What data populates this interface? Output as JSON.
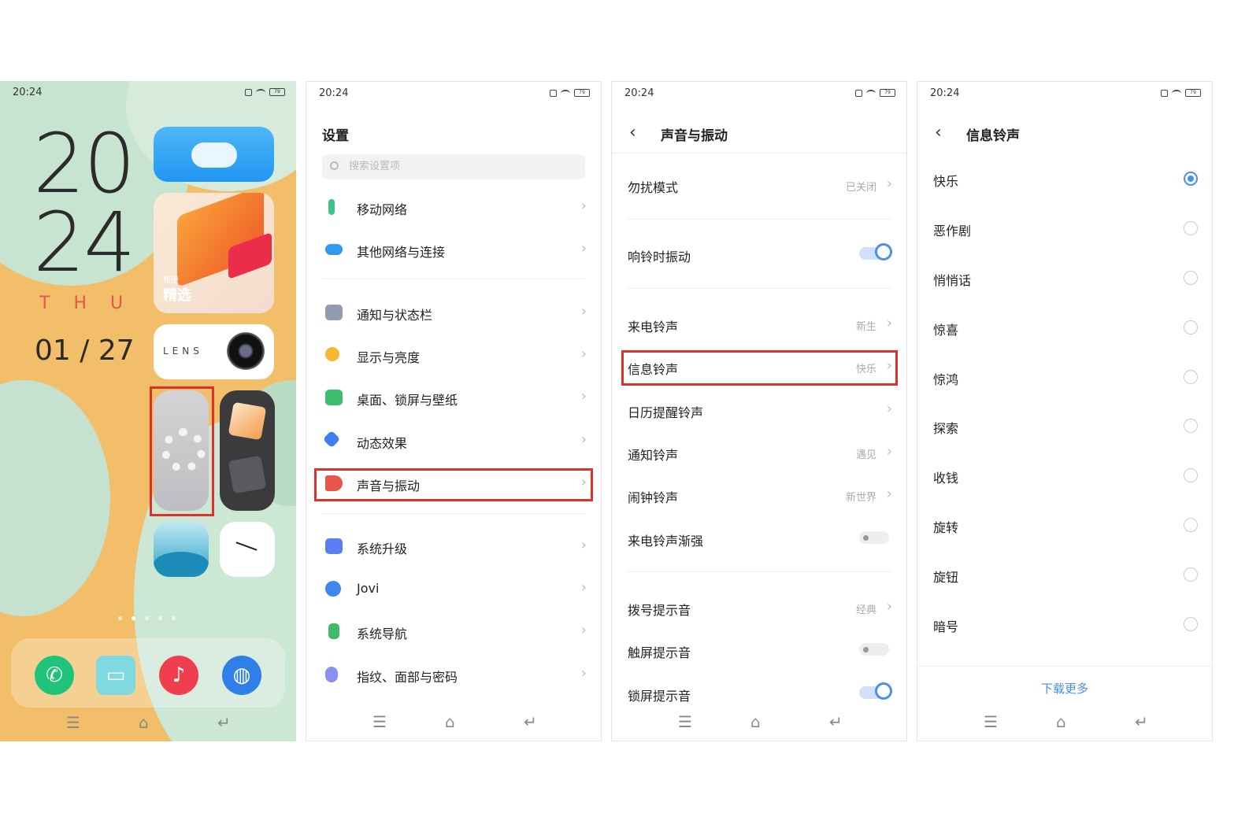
{
  "status": {
    "time": "20:24",
    "battery": "79"
  },
  "home": {
    "clock_hour": "20",
    "clock_minute": "24",
    "weekday_letters": [
      "T",
      "H",
      "U"
    ],
    "date": "01 / 27",
    "album_widget": {
      "sub": "相册",
      "title": "精选"
    },
    "lens_label": "LENS",
    "dock_icons": [
      "phone-icon",
      "messages-icon",
      "music-icon",
      "browser-icon"
    ]
  },
  "settings": {
    "title": "设置",
    "search_placeholder": "搜索设置项",
    "items": [
      {
        "label": "移动网络",
        "icon": "mobile-network-icon",
        "color": "#3cc38a"
      },
      {
        "label": "其他网络与连接",
        "icon": "connection-icon",
        "color": "#2e9af0"
      },
      {
        "label": "通知与状态栏",
        "icon": "notification-icon",
        "color": "#8e9bb0"
      },
      {
        "label": "显示与亮度",
        "icon": "brightness-icon",
        "color": "#f7b730"
      },
      {
        "label": "桌面、锁屏与壁纸",
        "icon": "wallpaper-icon",
        "color": "#3cbf6e"
      },
      {
        "label": "动态效果",
        "icon": "animation-icon",
        "color": "#3d7ff0"
      },
      {
        "label": "声音与振动",
        "icon": "sound-icon",
        "color": "#e9544b"
      },
      {
        "label": "系统升级",
        "icon": "upgrade-icon",
        "color": "#5b7ff2"
      },
      {
        "label": "Jovi",
        "icon": "jovi-icon",
        "color": "#3e86f0"
      },
      {
        "label": "系统导航",
        "icon": "navigation-icon",
        "color": "#3dbb6a"
      },
      {
        "label": "指纹、面部与密码",
        "icon": "fingerprint-icon",
        "color": "#8a8ff0"
      }
    ]
  },
  "sound": {
    "title": "声音与振动",
    "items": [
      {
        "label": "勿扰模式",
        "value": "已关闭",
        "type": "link"
      },
      {
        "label": "响铃时振动",
        "value": "",
        "type": "toggle-on"
      },
      {
        "label": "来电铃声",
        "value": "新生",
        "type": "link"
      },
      {
        "label": "信息铃声",
        "value": "快乐",
        "type": "link"
      },
      {
        "label": "日历提醒铃声",
        "value": "",
        "type": "link"
      },
      {
        "label": "通知铃声",
        "value": "遇见",
        "type": "link"
      },
      {
        "label": "闹钟铃声",
        "value": "新世界",
        "type": "link"
      },
      {
        "label": "来电铃声渐强",
        "value": "",
        "type": "toggle-off"
      },
      {
        "label": "拨号提示音",
        "value": "经典",
        "type": "link"
      },
      {
        "label": "触屏提示音",
        "value": "",
        "type": "toggle-off"
      },
      {
        "label": "锁屏提示音",
        "value": "",
        "type": "toggle-on"
      }
    ]
  },
  "ringtone": {
    "title": "信息铃声",
    "options": [
      "快乐",
      "恶作剧",
      "悄悄话",
      "惊喜",
      "惊鸿",
      "探索",
      "收钱",
      "旋转",
      "旋钮",
      "暗号"
    ],
    "selected_index": 0,
    "download_more": "下载更多"
  }
}
